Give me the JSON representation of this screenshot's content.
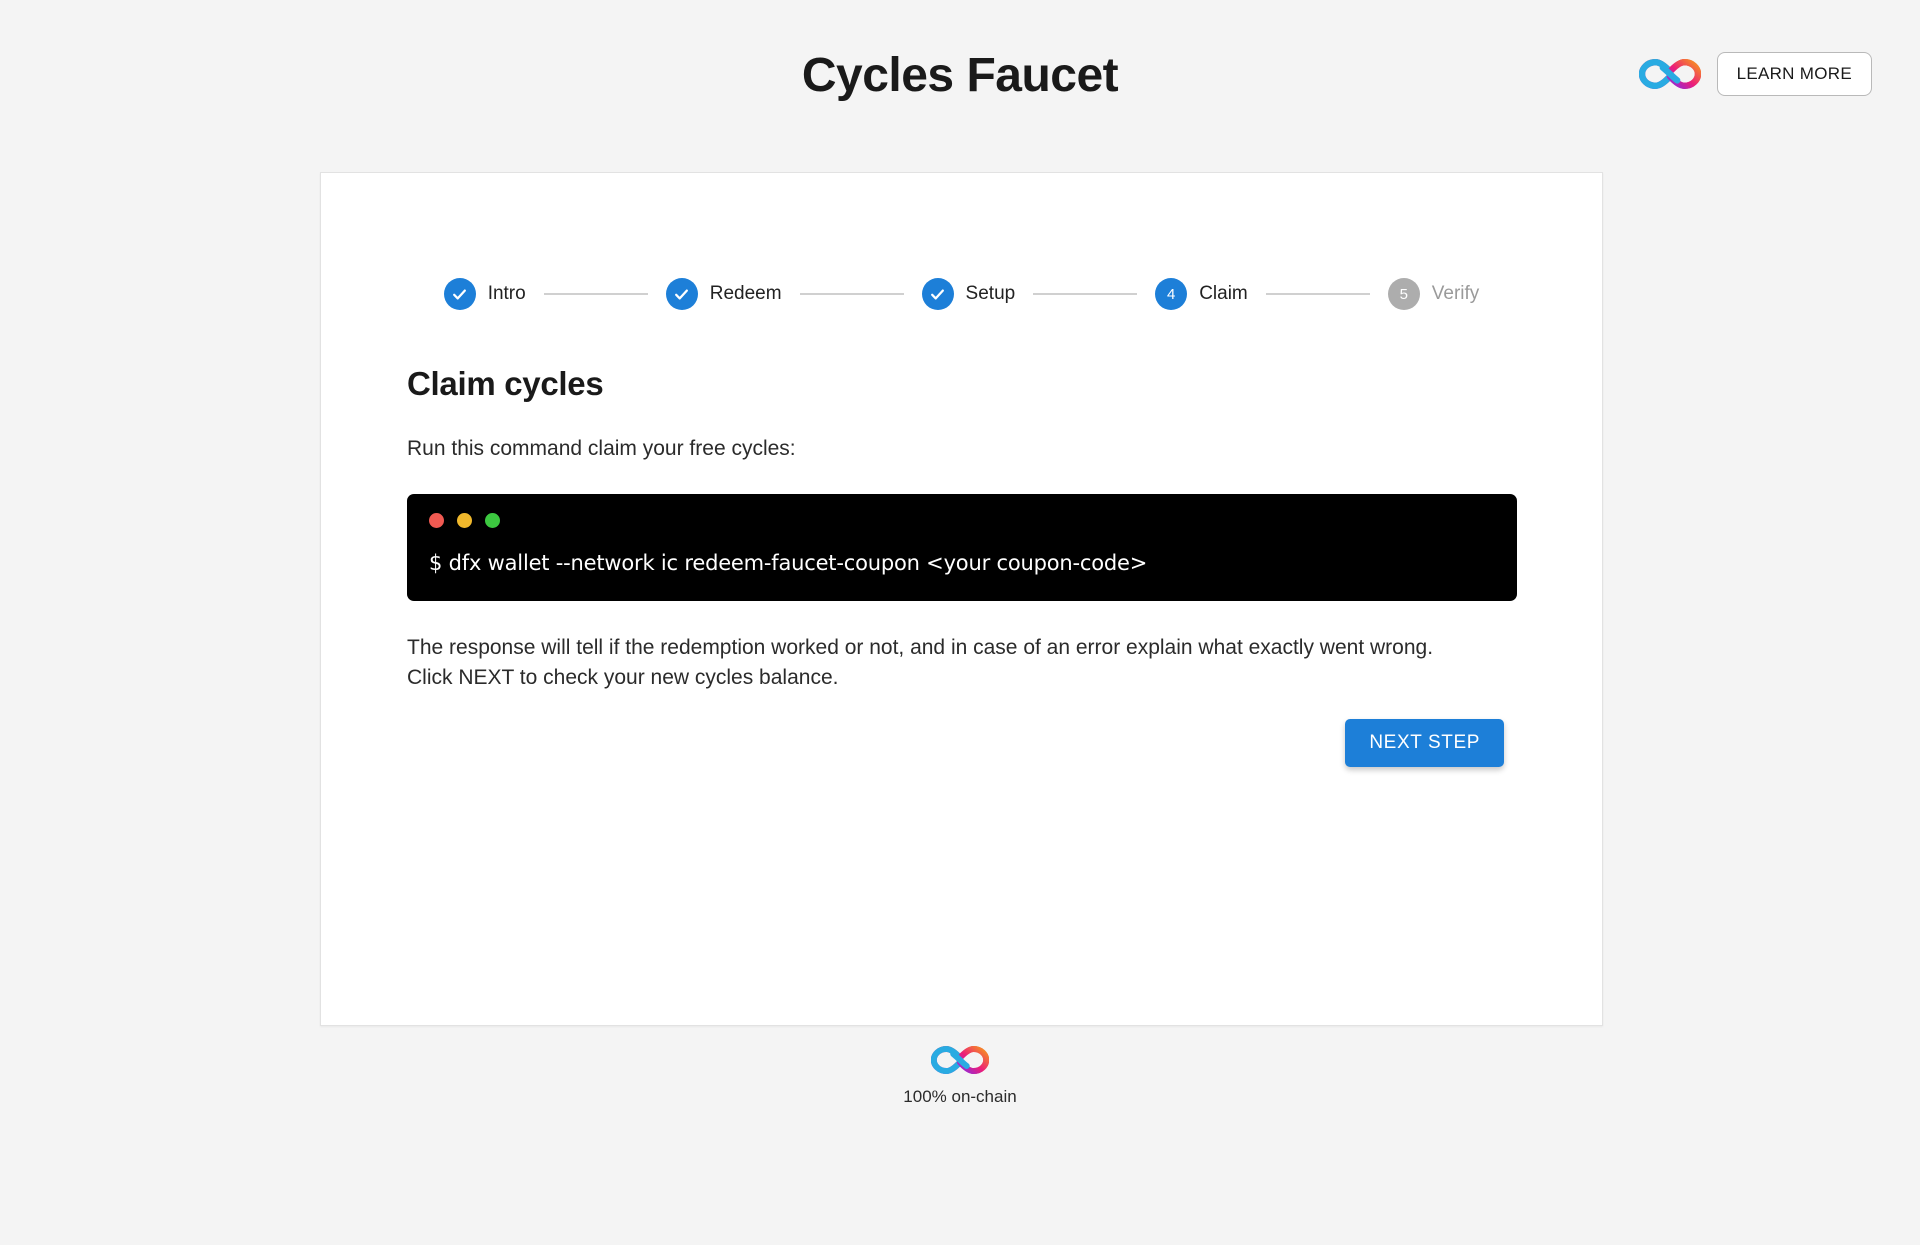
{
  "header": {
    "title": "Cycles Faucet",
    "logo_icon": "internet-computer-infinity-icon",
    "learn_more_label": "LEARN MORE"
  },
  "stepper": {
    "steps": [
      {
        "number": "1",
        "label": "Intro",
        "state": "done"
      },
      {
        "number": "2",
        "label": "Redeem",
        "state": "done"
      },
      {
        "number": "3",
        "label": "Setup",
        "state": "done"
      },
      {
        "number": "4",
        "label": "Claim",
        "state": "active"
      },
      {
        "number": "5",
        "label": "Verify",
        "state": "todo"
      }
    ]
  },
  "main": {
    "heading": "Claim cycles",
    "lead": "Run this command claim your free cycles:",
    "terminal": {
      "dots": [
        "red",
        "amber",
        "green"
      ],
      "command": "$ dfx wallet --network ic redeem-faucet-coupon <your coupon-code>"
    },
    "note": "The response will tell if the redemption worked or not, and in case of an error explain what exactly went wrong. Click NEXT to check your new cycles balance.",
    "next_step_label": "NEXT STEP"
  },
  "footer": {
    "logo_icon": "internet-computer-infinity-icon",
    "caption": "100% on-chain"
  },
  "colors": {
    "accent_blue": "#1d7fd8",
    "inactive_gray": "#adadad",
    "page_background": "#f4f4f4",
    "terminal_background": "#000000",
    "dot_red": "#f05a52",
    "dot_amber": "#f0b82c",
    "dot_green": "#3cc840"
  }
}
